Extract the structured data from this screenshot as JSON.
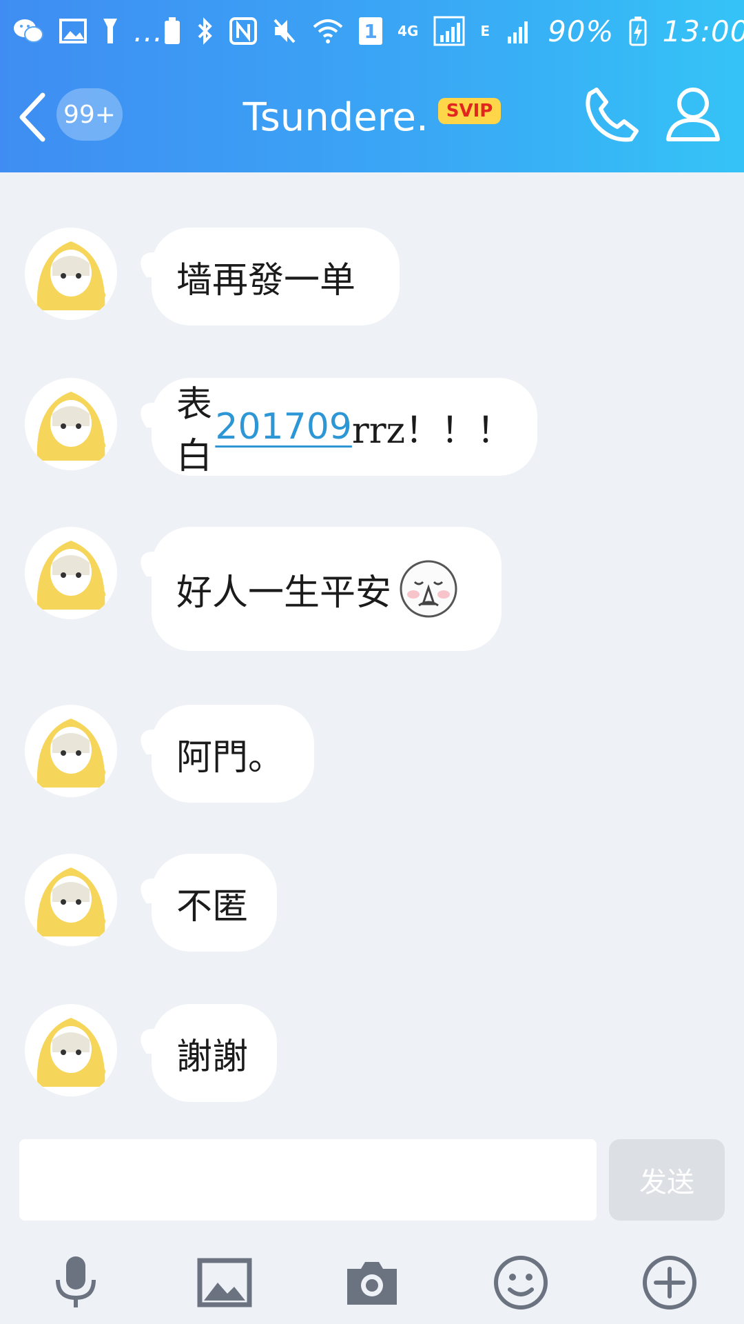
{
  "status_bar": {
    "sim_slot": "1",
    "network_4g": "4G",
    "network_e": "E",
    "more": "...",
    "battery": "90%",
    "time": "13:00"
  },
  "nav": {
    "unread_badge": "99+",
    "title": "Tsundere.",
    "vip_badge": "SVIP"
  },
  "messages": [
    {
      "text": "墙再發一单"
    },
    {
      "prefix": "表白",
      "link": "201709",
      "suffix": "rrz！！！"
    },
    {
      "text": "好人一生平安",
      "emoji": "pray-emoji"
    },
    {
      "text": "阿門。"
    },
    {
      "text": "不匿"
    },
    {
      "text": "謝謝"
    }
  ],
  "input": {
    "placeholder": "",
    "send_label": "发送"
  },
  "toolbar": [
    "microphone-icon",
    "image-icon",
    "camera-icon",
    "emoji-icon",
    "plus-icon"
  ],
  "colors": {
    "header_start": "#3f8df2",
    "header_end": "#35c3f6",
    "link": "#2d97d6",
    "svip_bg": "#ffd54a",
    "svip_text": "#e2261f",
    "background": "#eef1f6"
  }
}
